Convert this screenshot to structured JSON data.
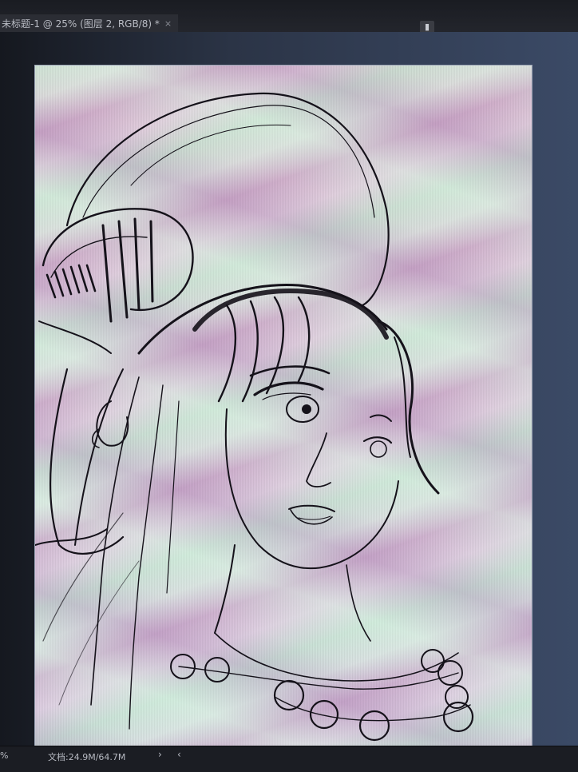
{
  "document_tab": {
    "title": "未标题-1 @ 25% (图层 2, RGB/8) *",
    "close_glyph": "×"
  },
  "panel_toggle_icon": "panel-collapse-icon",
  "status": {
    "zoom": "%",
    "doc_info": "文档:24.9M/64.7M",
    "arrow": "›",
    "scroll": "‹"
  },
  "colors": {
    "tabbar": "#23252c",
    "workspace": "#2b3446",
    "canvas_pink": "#e6d2e4",
    "canvas_green": "#d6f7df",
    "ink": "#15121a"
  }
}
